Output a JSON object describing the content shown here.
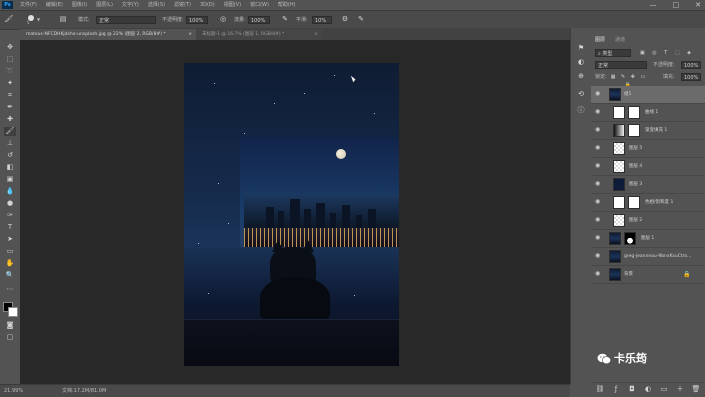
{
  "app": {
    "logo": "Ps"
  },
  "menubar": {
    "items": [
      "文件(F)",
      "编辑(E)",
      "图像(I)",
      "图层(L)",
      "文字(Y)",
      "选择(S)",
      "滤镜(T)",
      "3D(D)",
      "视图(V)",
      "窗口(W)",
      "帮助(H)"
    ],
    "window_buttons": [
      "—",
      "□",
      "✕"
    ]
  },
  "options_bar": {
    "mode_label": "模式:",
    "mode_value": "正常",
    "opacity_label": "不透明度:",
    "opacity_value": "100%",
    "flow_label": "流量:",
    "flow_value": "100%",
    "smoothing_label": "平滑:",
    "smoothing_value": "10%",
    "brush_size": "5"
  },
  "tabs": [
    {
      "label": "mateus-NFCDHKjdsho-unsplash.jpg @ 22% (图层 2, RGB/8#) *",
      "close": "×"
    },
    {
      "label": "未标题-1 @ 16.7% (图层 1, RGB/8#) *",
      "close": "×"
    }
  ],
  "tools": [
    "move-tool",
    "marquee-tool",
    "lasso-tool",
    "magic-wand-tool",
    "crop-tool",
    "eyedropper-tool",
    "healing-tool",
    "brush-tool",
    "stamp-tool",
    "history-brush-tool",
    "eraser-tool",
    "gradient-tool",
    "blur-tool",
    "dodge-tool",
    "pen-tool",
    "type-tool",
    "path-select-tool",
    "shape-tool",
    "hand-tool",
    "zoom-tool"
  ],
  "layers_panel": {
    "tab_active": "图层",
    "tab_inactive": "通道",
    "kind_filter": "类型",
    "blend_mode": "正常",
    "opacity_label": "不透明度:",
    "opacity_value": "100%",
    "lock_label": "锁定:",
    "fill_label": "填充:",
    "fill_value": "100%",
    "layers": [
      {
        "name": "组1",
        "thumb": "doc",
        "mask": null,
        "selected": true
      },
      {
        "name": "曲线 1",
        "thumb": "white",
        "mask": "white",
        "selected": false
      },
      {
        "name": "渐变填充 1",
        "thumb": "grad",
        "mask": "white",
        "selected": false
      },
      {
        "name": "图层 5",
        "thumb": "checker",
        "mask": null,
        "selected": false
      },
      {
        "name": "图层 4",
        "thumb": "checker",
        "mask": null,
        "selected": false
      },
      {
        "name": "图层 3",
        "thumb": "navy",
        "mask": null,
        "selected": false
      },
      {
        "name": "色相/饱和度 1",
        "thumb": "white",
        "mask": "white",
        "selected": false
      },
      {
        "name": "图层 2",
        "thumb": "checker",
        "mask": null,
        "selected": false
      },
      {
        "name": "图层 1",
        "thumb": "doc",
        "mask": "mask2",
        "selected": false
      },
      {
        "name": "greg-jeanneau-9bnxKsuCtro...",
        "thumb": "doc",
        "mask": null,
        "selected": false
      },
      {
        "name": "背景",
        "thumb": "doc",
        "mask": null,
        "selected": false
      }
    ],
    "bottom_icons": [
      "link-icon",
      "fx-icon",
      "mask-icon",
      "adjustment-icon",
      "folder-icon",
      "new-layer-icon",
      "trash-icon"
    ]
  },
  "status": {
    "zoom": "21.99%",
    "doc_info": "文档:17.2M/81.0M"
  },
  "watermark": {
    "text": "卡乐筠"
  },
  "colors": {
    "accent": "#31a8ff",
    "bg": "#535353",
    "canvas": "#282828"
  }
}
